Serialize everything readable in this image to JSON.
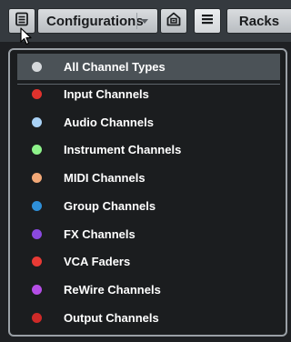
{
  "toolbar": {
    "menu_icon": "list-menu-icon",
    "configurations_label": "Configurations",
    "save_icon": "save-configuration-icon",
    "lines_icon": "hamburger-icon",
    "racks_label": "Racks"
  },
  "menu": {
    "items": [
      {
        "label": "All Channel Types",
        "color": "#d6d9dc"
      },
      {
        "label": "Input Channels",
        "color": "#e0322d"
      },
      {
        "label": "Audio Channels",
        "color": "#a9d2f6"
      },
      {
        "label": "Instrument Channels",
        "color": "#8ef28a"
      },
      {
        "label": "MIDI Channels",
        "color": "#f2a877"
      },
      {
        "label": "Group Channels",
        "color": "#2e8fd8"
      },
      {
        "label": "FX Channels",
        "color": "#8a49e0"
      },
      {
        "label": "VCA Faders",
        "color": "#e83a35"
      },
      {
        "label": "ReWire Channels",
        "color": "#b54ee6"
      },
      {
        "label": "Output Channels",
        "color": "#cf2a28"
      }
    ]
  }
}
